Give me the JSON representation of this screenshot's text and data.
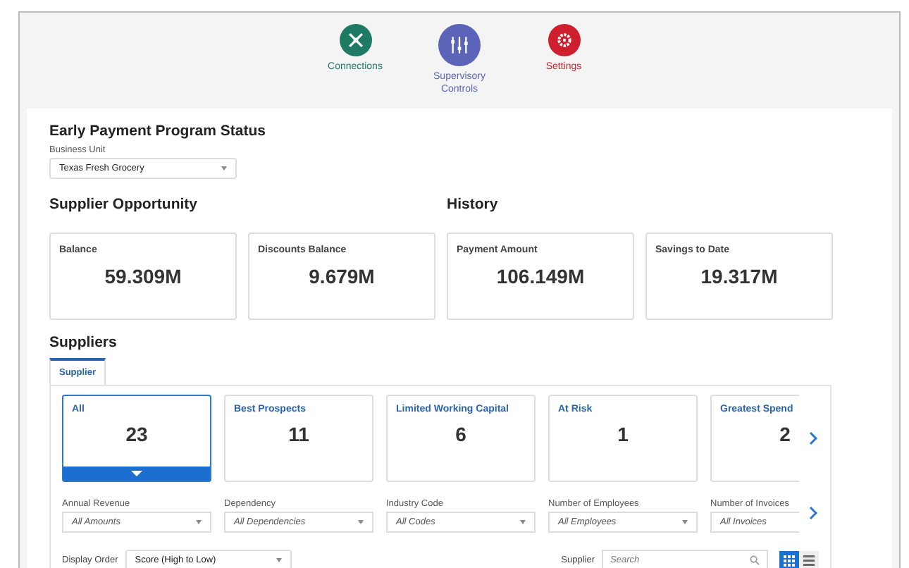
{
  "nav": [
    {
      "label": "Connections",
      "color": "#1f7a64",
      "kind": "connections",
      "selected": false
    },
    {
      "label": "Supervisory Controls",
      "color": "#5b64b8",
      "kind": "controls",
      "selected": true
    },
    {
      "label": "Settings",
      "color": "#cf1f2e",
      "kind": "settings",
      "selected": false
    }
  ],
  "title": "Early Payment Program Status",
  "business_unit": {
    "label": "Business Unit",
    "value": "Texas Fresh Grocery"
  },
  "sections": [
    {
      "title": "Supplier Opportunity",
      "cards": [
        {
          "label": "Balance",
          "value": "59.309M"
        },
        {
          "label": "Discounts Balance",
          "value": "9.679M"
        }
      ]
    },
    {
      "title": "History",
      "cards": [
        {
          "label": "Payment Amount",
          "value": "106.149M"
        },
        {
          "label": "Savings to Date",
          "value": "19.317M"
        }
      ]
    }
  ],
  "suppliers": {
    "title": "Suppliers",
    "tabs": [
      {
        "label": "Supplier",
        "selected": true
      }
    ],
    "tiles": [
      {
        "label": "All",
        "count": "23",
        "selected": true
      },
      {
        "label": "Best Prospects",
        "count": "11",
        "selected": false
      },
      {
        "label": "Limited Working Capital",
        "count": "6",
        "selected": false
      },
      {
        "label": "At Risk",
        "count": "1",
        "selected": false
      },
      {
        "label": "Greatest Spend",
        "count": "2",
        "selected": false
      }
    ],
    "filters": [
      {
        "label": "Annual Revenue",
        "placeholder": "All Amounts"
      },
      {
        "label": "Dependency",
        "placeholder": "All Dependencies"
      },
      {
        "label": "Industry Code",
        "placeholder": "All Codes"
      },
      {
        "label": "Number of Employees",
        "placeholder": "All Employees"
      },
      {
        "label": "Number of Invoices",
        "placeholder": "All Invoices"
      }
    ],
    "display_order": {
      "label": "Display Order",
      "value": "Score (High to Low)"
    },
    "search": {
      "label": "Supplier",
      "placeholder": "Search"
    },
    "views": [
      {
        "kind": "grid",
        "selected": true
      },
      {
        "kind": "list",
        "selected": false
      }
    ]
  }
}
